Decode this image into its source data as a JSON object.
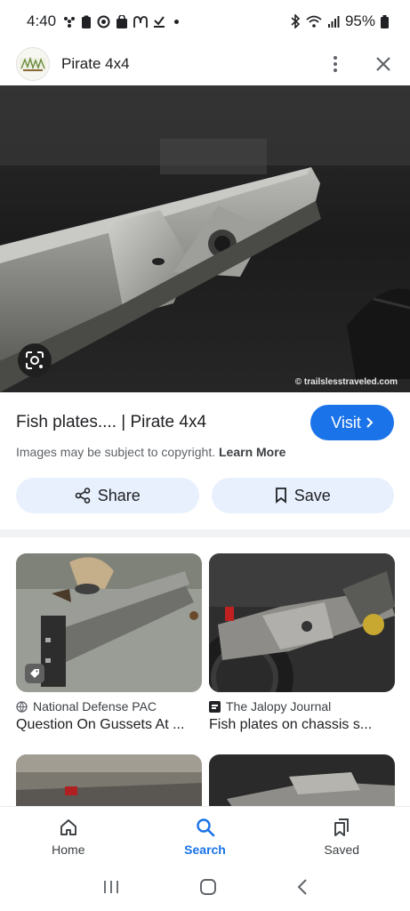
{
  "status_bar": {
    "time": "4:40",
    "battery": "95%"
  },
  "header": {
    "site_name": "Pirate 4x4"
  },
  "main_image": {
    "credit": "© trailslesstraveled.com"
  },
  "result": {
    "title": "Fish plates.... | Pirate 4x4",
    "visit_label": "Visit",
    "copyright_text": "Images may be subject to copyright.",
    "learn_more": "Learn More"
  },
  "actions": {
    "share": "Share",
    "save": "Save"
  },
  "related": [
    {
      "source": "National Defense PAC",
      "title": "Question On Gussets At ...",
      "icon": "globe-icon"
    },
    {
      "source": "The Jalopy Journal",
      "title": "Fish plates on chassis s...",
      "icon": "site-favicon"
    }
  ],
  "bottom_nav": {
    "home": "Home",
    "search": "Search",
    "saved": "Saved",
    "active": "search"
  },
  "colors": {
    "accent": "#1a73e8",
    "chip_bg": "#e8f0fe"
  }
}
